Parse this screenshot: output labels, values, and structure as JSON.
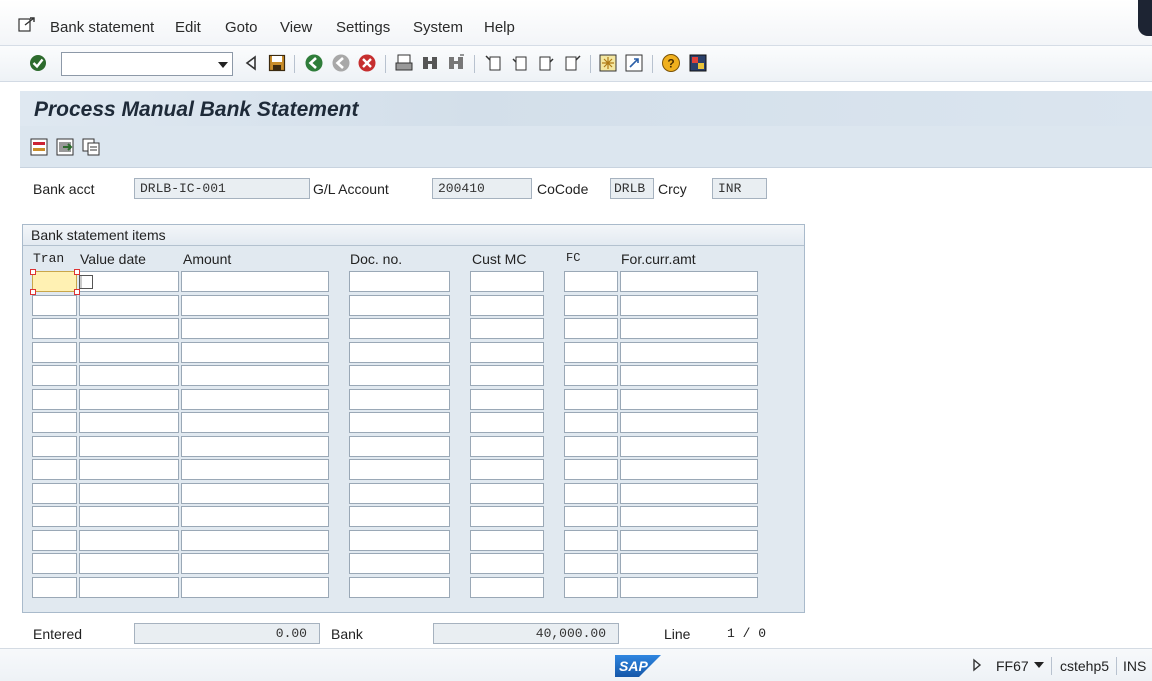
{
  "menu": {
    "items": [
      "Bank statement",
      "Edit",
      "Goto",
      "View",
      "Settings",
      "System",
      "Help"
    ]
  },
  "toolbar": {
    "command_value": "",
    "icons": [
      "enter-icon",
      "back-arrow-icon",
      "save-icon",
      "back-icon",
      "exit-icon",
      "cancel-icon",
      "print-icon",
      "find-icon",
      "find-next-icon",
      "first-page-icon",
      "previous-page-icon",
      "next-page-icon",
      "last-page-icon",
      "create-session-icon",
      "shortcut-icon",
      "help-icon",
      "customize-layout-icon"
    ]
  },
  "title": "Process Manual Bank Statement",
  "header": {
    "bank_acct_label": "Bank acct",
    "bank_acct_value": "DRLB-IC-001",
    "gl_account_label": "G/L Account",
    "gl_account_value": "200410",
    "cocode_label": "CoCode",
    "cocode_value": "DRLB",
    "crcy_label": "Crcy",
    "crcy_value": "INR"
  },
  "table": {
    "title": "Bank statement items",
    "columns": [
      "Tran",
      "Value date",
      "Amount",
      "Doc. no.",
      "Cust MC",
      "FC",
      "For.curr.amt"
    ],
    "row_count": 14
  },
  "footer": {
    "entered_label": "Entered",
    "entered_value": "0.00",
    "bank_label": "Bank",
    "bank_value": "40,000.00",
    "line_label": "Line",
    "line_value": "1 / 0"
  },
  "status": {
    "transaction": "FF67",
    "server": "cstehp5",
    "mode": "INS",
    "logo": "SAP"
  },
  "colors": {
    "accent_blue": "#dce6ef",
    "active_cell": "#fff1b3",
    "logo_blue": "#1f6fc9"
  }
}
